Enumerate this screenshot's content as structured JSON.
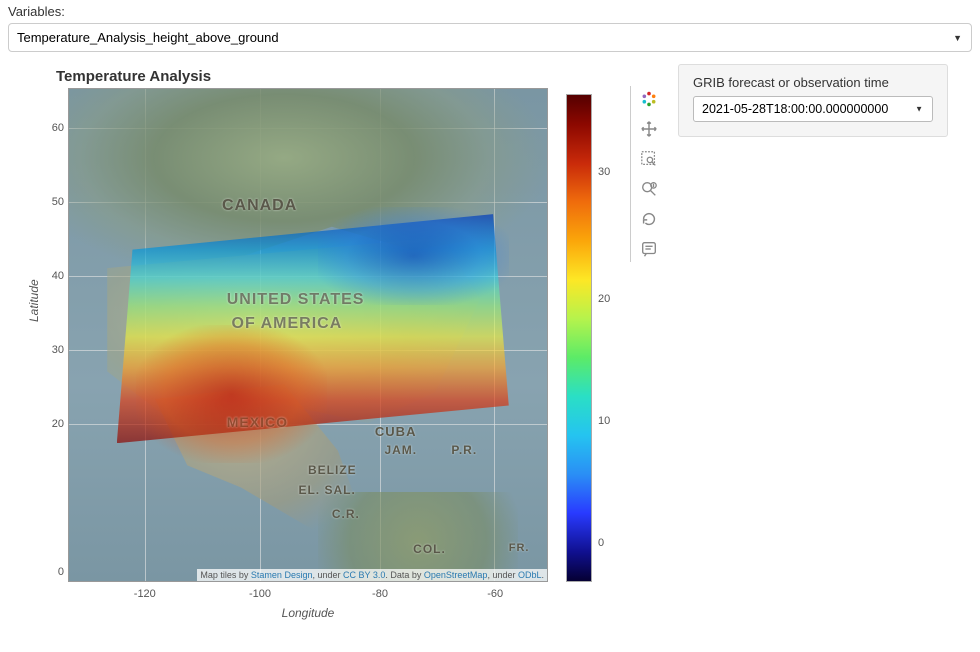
{
  "variables": {
    "label": "Variables:",
    "selected": "Temperature_Analysis_height_above_ground"
  },
  "plot": {
    "title": "Temperature Analysis",
    "x_axis_label": "Longitude",
    "y_axis_label": "Latitude",
    "y_ticks": [
      "0",
      "20",
      "30",
      "40",
      "50",
      "60"
    ],
    "x_ticks": [
      "-120",
      "-100",
      "-80",
      "-60"
    ],
    "map_labels": {
      "canada": "CANADA",
      "usa1": "UNITED STATES",
      "usa2": "OF AMERICA",
      "mexico": "MEXICO",
      "cuba": "CUBA",
      "jam": "JAM.",
      "pr": "P.R.",
      "belize": "BELIZE",
      "elsal": "EL. SAL.",
      "cr": "C.R.",
      "col": "COL.",
      "fr": "FR."
    },
    "attribution": {
      "prefix": "Map tiles by ",
      "stamen": "Stamen Design",
      "under1": ", under ",
      "cc": "CC BY 3.0",
      "databy": ". Data by ",
      "osm": "OpenStreetMap",
      "under2": ", under ",
      "odbl": "ODbL"
    },
    "colorbar_ticks": [
      "30",
      "20",
      "10",
      "0"
    ]
  },
  "toolbar": {
    "tools": [
      "bokeh-logo",
      "pan",
      "box-zoom",
      "wheel-zoom",
      "reset",
      "hover"
    ]
  },
  "side": {
    "label": "GRIB forecast or observation time",
    "selected": "2021-05-28T18:00:00.000000000"
  }
}
